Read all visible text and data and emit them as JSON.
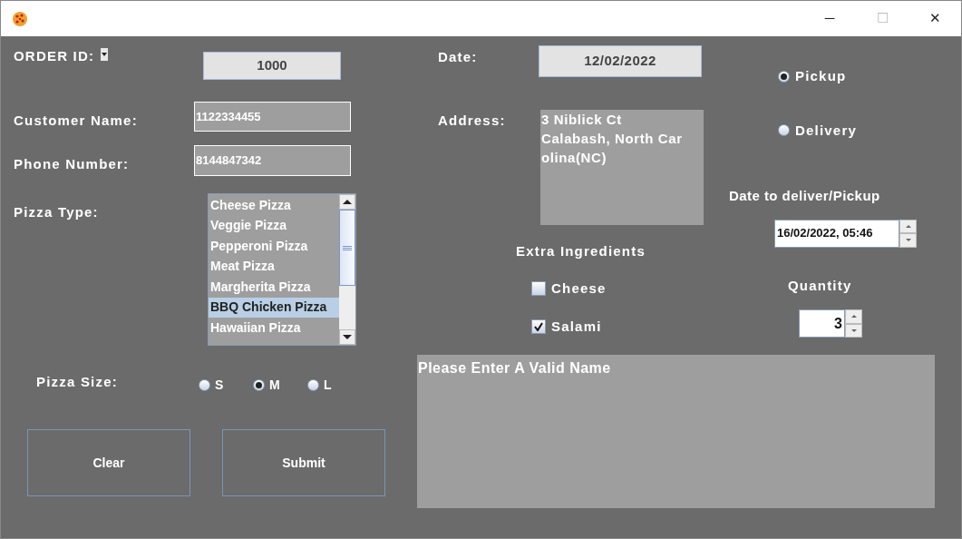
{
  "window": {
    "controls": [
      "─",
      "☐",
      "✕"
    ]
  },
  "order_id": {
    "label": "ORDER ID:",
    "value": "1000"
  },
  "customer_name": {
    "label": "Customer Name:",
    "value": "1122334455"
  },
  "phone_number": {
    "label": "Phone Number:",
    "value": "8144847342"
  },
  "pizza_type": {
    "label": "Pizza Type:",
    "items": [
      {
        "label": "Cheese Pizza",
        "selected": false
      },
      {
        "label": "Veggie Pizza",
        "selected": false
      },
      {
        "label": "Pepperoni Pizza",
        "selected": false
      },
      {
        "label": "Meat Pizza",
        "selected": false
      },
      {
        "label": "Margherita Pizza",
        "selected": false
      },
      {
        "label": "BBQ Chicken Pizza",
        "selected": true
      },
      {
        "label": "Hawaiian Pizza",
        "selected": false
      }
    ]
  },
  "pizza_size": {
    "label": "Pizza Size:",
    "options": [
      {
        "label": "S",
        "selected": false
      },
      {
        "label": "M",
        "selected": true
      },
      {
        "label": "L",
        "selected": false
      }
    ]
  },
  "buttons": [
    "Clear",
    "Submit"
  ],
  "date": {
    "label": "Date:",
    "value": "12/02/2022"
  },
  "address": {
    "label": "Address:",
    "lines": [
      "3 Niblick Ct",
      "Calabash, North Car",
      "olina(NC)"
    ]
  },
  "extra_ingredients": {
    "label": "Extra Ingredients",
    "items": [
      {
        "label": "Cheese",
        "checked": false
      },
      {
        "label": "Salami",
        "checked": true
      }
    ]
  },
  "order_mode": [
    {
      "label": "Pickup",
      "selected": true
    },
    {
      "label": "Delivery",
      "selected": false
    }
  ],
  "deliver_date": {
    "label": "Date to deliver/Pickup",
    "value": "16/02/2022, 05:46"
  },
  "quantity": {
    "label": "Quantity",
    "value": "3"
  },
  "message": "Please Enter A Valid Name"
}
